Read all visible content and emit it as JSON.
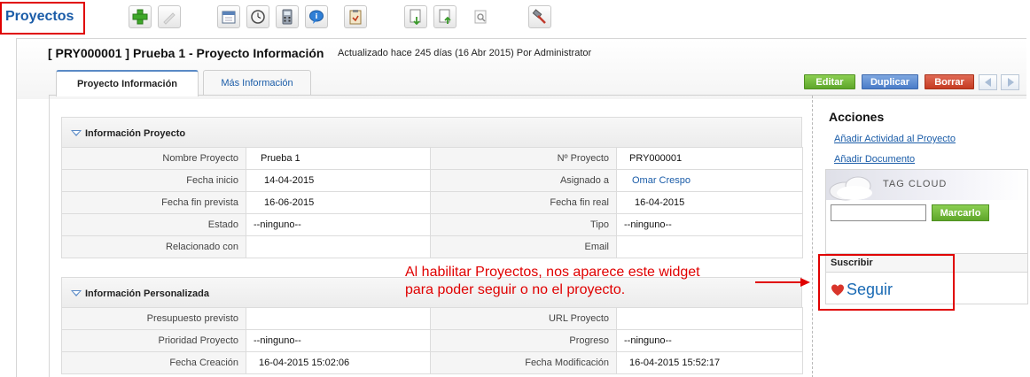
{
  "header": {
    "module_title": "Proyectos",
    "toolbar": [
      {
        "name": "create-button",
        "icon": "plus-icon"
      },
      {
        "name": "edit-button",
        "icon": "pencil-icon"
      },
      {
        "name": "calendar-button",
        "icon": "calendar-icon"
      },
      {
        "name": "clock-button",
        "icon": "clock-icon"
      },
      {
        "name": "calculator-button",
        "icon": "calculator-icon"
      },
      {
        "name": "chat-button",
        "icon": "speech-bubble-icon"
      },
      {
        "name": "clipboard-button",
        "icon": "clipboard-icon"
      },
      {
        "name": "import-button",
        "icon": "import-icon"
      },
      {
        "name": "export-button",
        "icon": "export-icon"
      },
      {
        "name": "find-duplicates-button",
        "icon": "search-document-icon"
      },
      {
        "name": "tools-button",
        "icon": "hammer-icon"
      }
    ]
  },
  "record": {
    "title": "[ PRY000001 ] Prueba 1 - Proyecto Información",
    "subtitle": "Actualizado hace 245 días (16 Abr 2015) Por Administrator"
  },
  "tabs": [
    {
      "label": "Proyecto Información",
      "active": true
    },
    {
      "label": "Más Información",
      "active": false
    }
  ],
  "actions": {
    "edit": "Editar",
    "duplicate": "Duplicar",
    "delete": "Borrar"
  },
  "sections": [
    {
      "title": "Información Proyecto",
      "rows": [
        [
          {
            "label": "Nombre Proyecto",
            "value": "Prueba 1"
          },
          {
            "label": "Nº Proyecto",
            "value": "PRY000001"
          }
        ],
        [
          {
            "label": "Fecha inicio",
            "value": "14-04-2015"
          },
          {
            "label": "Asignado a",
            "value": "Omar Crespo"
          }
        ],
        [
          {
            "label": "Fecha fin prevista",
            "value": "16-06-2015"
          },
          {
            "label": "Fecha fin real",
            "value": "16-04-2015"
          }
        ],
        [
          {
            "label": "Estado",
            "value": "--ninguno--"
          },
          {
            "label": "Tipo",
            "value": "--ninguno--"
          }
        ],
        [
          {
            "label": "Relacionado con",
            "value": ""
          },
          {
            "label": "Email",
            "value": ""
          }
        ]
      ]
    },
    {
      "title": "Información Personalizada",
      "rows": [
        [
          {
            "label": "Presupuesto previsto",
            "value": ""
          },
          {
            "label": "URL Proyecto",
            "value": ""
          }
        ],
        [
          {
            "label": "Prioridad Proyecto",
            "value": "--ninguno--"
          },
          {
            "label": "Progreso",
            "value": "--ninguno--"
          }
        ],
        [
          {
            "label": "Fecha Creación",
            "value": "16-04-2015 15:02:06"
          },
          {
            "label": "Fecha Modificación",
            "value": "16-04-2015 15:52:17"
          }
        ]
      ]
    }
  ],
  "sidebar": {
    "title": "Acciones",
    "links": [
      "Añadir Actividad al Proyecto",
      "Añadir Documento"
    ],
    "tag_cloud": {
      "label": "TAG CLOUD",
      "input_value": "",
      "button": "Marcarlo"
    },
    "subscribe": {
      "title": "Suscribir",
      "follow_label": "Seguir"
    }
  },
  "annotation": {
    "text": "Al habilitar Proyectos, nos aparece este widget\npara poder seguir o no el proyecto."
  },
  "colors": {
    "accent": "#1a5ca8",
    "annotation_red": "#e00000",
    "edit_green": "#6cb43a",
    "duplicate_blue": "#5b8ad2",
    "delete_red": "#d04a30"
  }
}
